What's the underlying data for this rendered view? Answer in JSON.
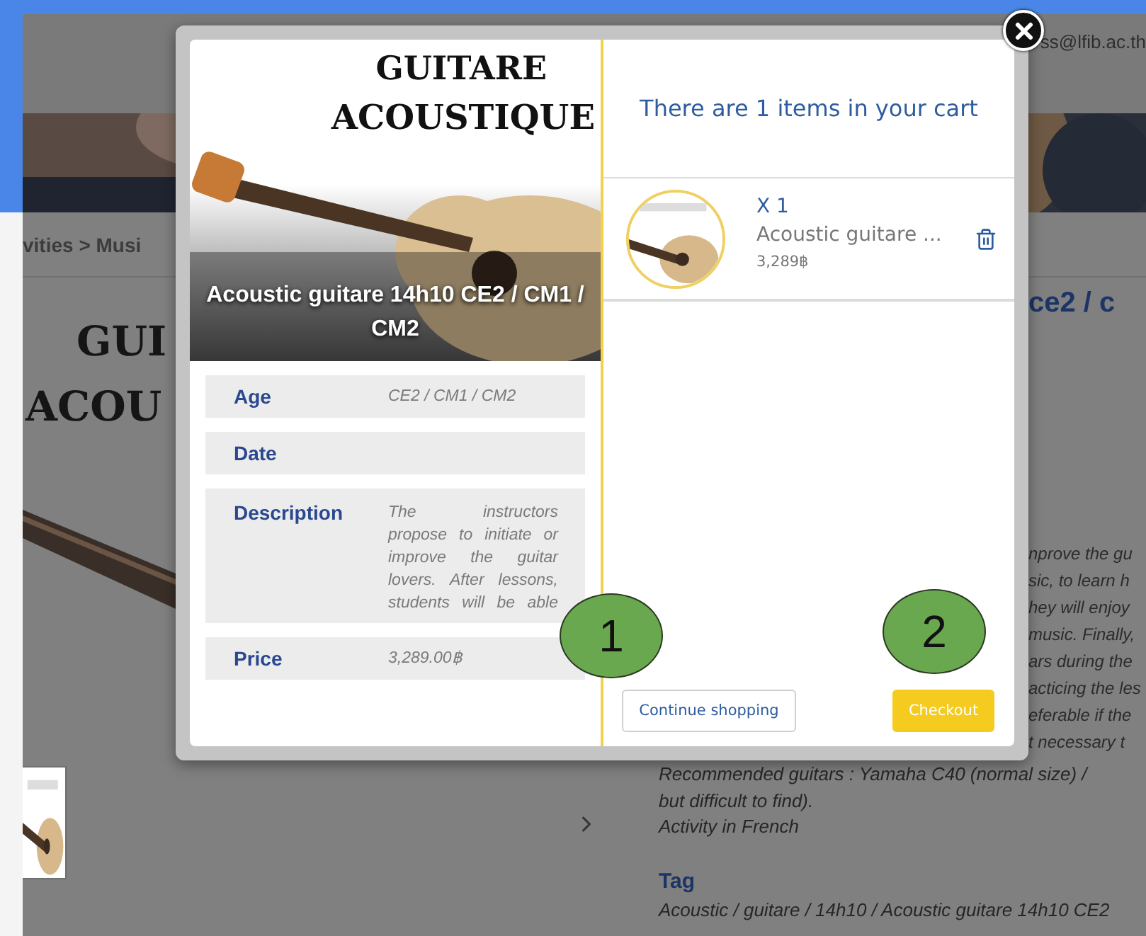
{
  "account": {
    "email": "ss@lfib.ac.th"
  },
  "breadcrumb": "vities > Musi",
  "background_logo": [
    "GUI",
    "ACOU"
  ],
  "product_title": "ce2 / c",
  "description_fragments": [
    "nprove the gu",
    "sic, to learn h",
    "hey will enjoy",
    "music. Finally,",
    "ars during the",
    "acticing the les",
    "eferable if the",
    "t necessary t"
  ],
  "description_lines": [
    "Recommended guitars : Yamaha C40 (normal size) /",
    "but difficult to find).",
    "Activity in French"
  ],
  "tag": {
    "label": "Tag",
    "value": "Acoustic / guitare / 14h10 / Acoustic guitare 14h10 CE2"
  },
  "modal": {
    "image_title": [
      "GUITARE",
      "ACOUSTIQUE"
    ],
    "caption": "Acoustic guitare 14h10 CE2 / CM1 / CM2",
    "details": [
      {
        "label": "Age",
        "value": "CE2 / CM1 / CM2"
      },
      {
        "label": "Date"
      },
      {
        "label": "Description",
        "value": "The instructors propose to initiate or improve the guitar lovers. After lessons, students will be able"
      },
      {
        "label": "Price",
        "value": "3,289.00฿"
      }
    ],
    "cart": {
      "heading": "There are 1 items in your cart",
      "items": [
        {
          "quantity": "X 1",
          "name": "Acoustic guitare ...",
          "price": "3,289฿"
        }
      ]
    },
    "buttons": [
      {
        "label": "Continue shopping",
        "kind": "secondary"
      },
      {
        "label": "Checkout",
        "kind": "primary"
      }
    ]
  },
  "annotations": [
    "1",
    "2"
  ]
}
